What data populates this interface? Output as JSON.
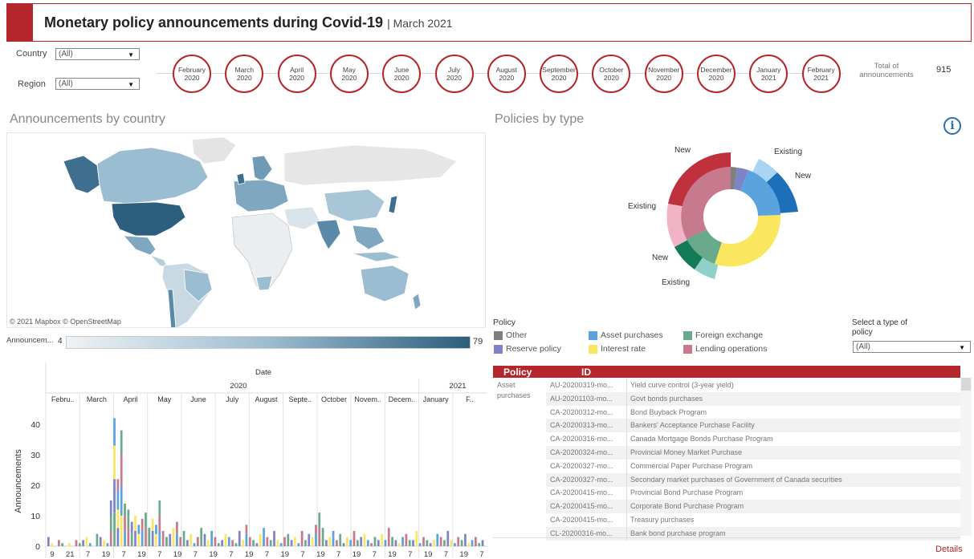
{
  "header": {
    "title": "Monetary policy announcements during Covid-19",
    "subtitle": "| March 2021"
  },
  "filters": {
    "country_label": "Country",
    "country_value": "(All)",
    "region_label": "Region",
    "region_value": "(All)"
  },
  "months": [
    {
      "m": "February",
      "y": "2020"
    },
    {
      "m": "March",
      "y": "2020"
    },
    {
      "m": "April",
      "y": "2020"
    },
    {
      "m": "May",
      "y": "2020"
    },
    {
      "m": "June",
      "y": "2020"
    },
    {
      "m": "July",
      "y": "2020"
    },
    {
      "m": "August",
      "y": "2020"
    },
    {
      "m": "September",
      "y": "2020"
    },
    {
      "m": "October",
      "y": "2020"
    },
    {
      "m": "November",
      "y": "2020"
    },
    {
      "m": "December",
      "y": "2020"
    },
    {
      "m": "January",
      "y": "2021"
    },
    {
      "m": "February",
      "y": "2021"
    }
  ],
  "total": {
    "label": "Total of announcements",
    "value": "915"
  },
  "map_section": {
    "title": "Announcements by country",
    "credit": "© 2021 Mapbox  © OpenStreetMap",
    "legend_label": "Announcem...",
    "legend_min": "4",
    "legend_max": "79"
  },
  "policies_section": {
    "title": "Policies by type",
    "sunburst_labels": [
      "New",
      "Existing",
      "New",
      "Existing",
      "New",
      "Existing"
    ],
    "legend_title": "Policy",
    "legend": [
      {
        "label": "Other",
        "color": "#7f7f7f"
      },
      {
        "label": "Asset purchases",
        "color": "#5ba3dd"
      },
      {
        "label": "Foreign exchange",
        "color": "#69a98c"
      },
      {
        "label": "Reserve policy",
        "color": "#7e83c8"
      },
      {
        "label": "Interest rate",
        "color": "#fbe660"
      },
      {
        "label": "Lending operations",
        "color": "#c77a8e"
      }
    ],
    "select_label": "Select a type of policy",
    "select_value": "(All)"
  },
  "table": {
    "headers": [
      "Policy",
      "ID"
    ],
    "group": "Asset purchases",
    "rows": [
      {
        "id": "AU-20200319-mo...",
        "desc": "Yield curve control (3-year yield)"
      },
      {
        "id": "AU-20201103-mo...",
        "desc": "Govt bonds purchases"
      },
      {
        "id": "CA-20200312-mo...",
        "desc": "Bond Buyback Program"
      },
      {
        "id": "CA-20200313-mo...",
        "desc": "Bankers' Acceptance Purchase Facility"
      },
      {
        "id": "CA-20200316-mo...",
        "desc": "Canada Mortgage Bonds Purchase Program"
      },
      {
        "id": "CA-20200324-mo...",
        "desc": "Provincial Money Market Purchase"
      },
      {
        "id": "CA-20200327-mo...",
        "desc": "Commercial Paper Purchase Program"
      },
      {
        "id": "CA-20200327-mo...",
        "desc": "Secondary market purchases of Government of Canada securities"
      },
      {
        "id": "CA-20200415-mo...",
        "desc": "Provincial Bond Purchase Program"
      },
      {
        "id": "CA-20200415-mo...",
        "desc": "Corporate Bond Purchase Program"
      },
      {
        "id": "CA-20200415-mo...",
        "desc": "Treasury purchases"
      },
      {
        "id": "CL-20200316-mo...",
        "desc": "Bank bond purchase program"
      }
    ],
    "details_link": "Details"
  },
  "chart_data": {
    "type": "bar",
    "title": "Date",
    "year_labels": [
      "2020",
      "2021"
    ],
    "month_headers": [
      "Febru..",
      "March",
      "April",
      "May",
      "June",
      "July",
      "August",
      "Septe..",
      "October",
      "Novem..",
      "Decem..",
      "January",
      "F.."
    ],
    "ylabel": "Announcements",
    "yticks": [
      0,
      10,
      20,
      30,
      40
    ],
    "ylim": [
      0,
      45
    ],
    "day_ticks": [
      "9",
      "21",
      "7",
      "19",
      "7",
      "19",
      "7",
      "19",
      "7",
      "19",
      "7",
      "19",
      "7",
      "19",
      "7",
      "19",
      "7",
      "19",
      "7",
      "19",
      "7",
      "19",
      "7",
      "19",
      "7"
    ],
    "values": [
      3,
      1,
      0,
      2,
      1,
      0,
      1,
      0,
      2,
      1,
      2,
      3,
      1,
      0,
      4,
      3,
      2,
      1,
      15,
      42,
      22,
      38,
      14,
      12,
      8,
      10,
      7,
      9,
      11,
      6,
      9,
      7,
      15,
      5,
      3,
      4,
      6,
      8,
      3,
      5,
      2,
      4,
      1,
      3,
      6,
      4,
      2,
      5,
      3,
      1,
      2,
      4,
      3,
      2,
      1,
      5,
      2,
      7,
      3,
      2,
      1,
      4,
      6,
      3,
      2,
      5,
      2,
      1,
      3,
      4,
      2,
      3,
      1,
      5,
      2,
      4,
      3,
      7,
      11,
      6,
      2,
      3,
      5,
      2,
      4,
      1,
      3,
      2,
      5,
      2,
      3,
      4,
      2,
      1,
      3,
      2,
      4,
      2,
      6,
      3,
      2,
      1,
      3,
      4,
      2,
      2,
      5,
      1,
      3,
      2,
      1,
      2,
      4,
      3,
      2,
      5,
      2,
      1,
      3,
      2,
      4,
      1,
      2,
      3,
      1,
      2
    ],
    "series_colors": [
      "#7e83c8",
      "#fbe660",
      "#5ba3dd",
      "#c77a8e",
      "#69a98c"
    ]
  }
}
